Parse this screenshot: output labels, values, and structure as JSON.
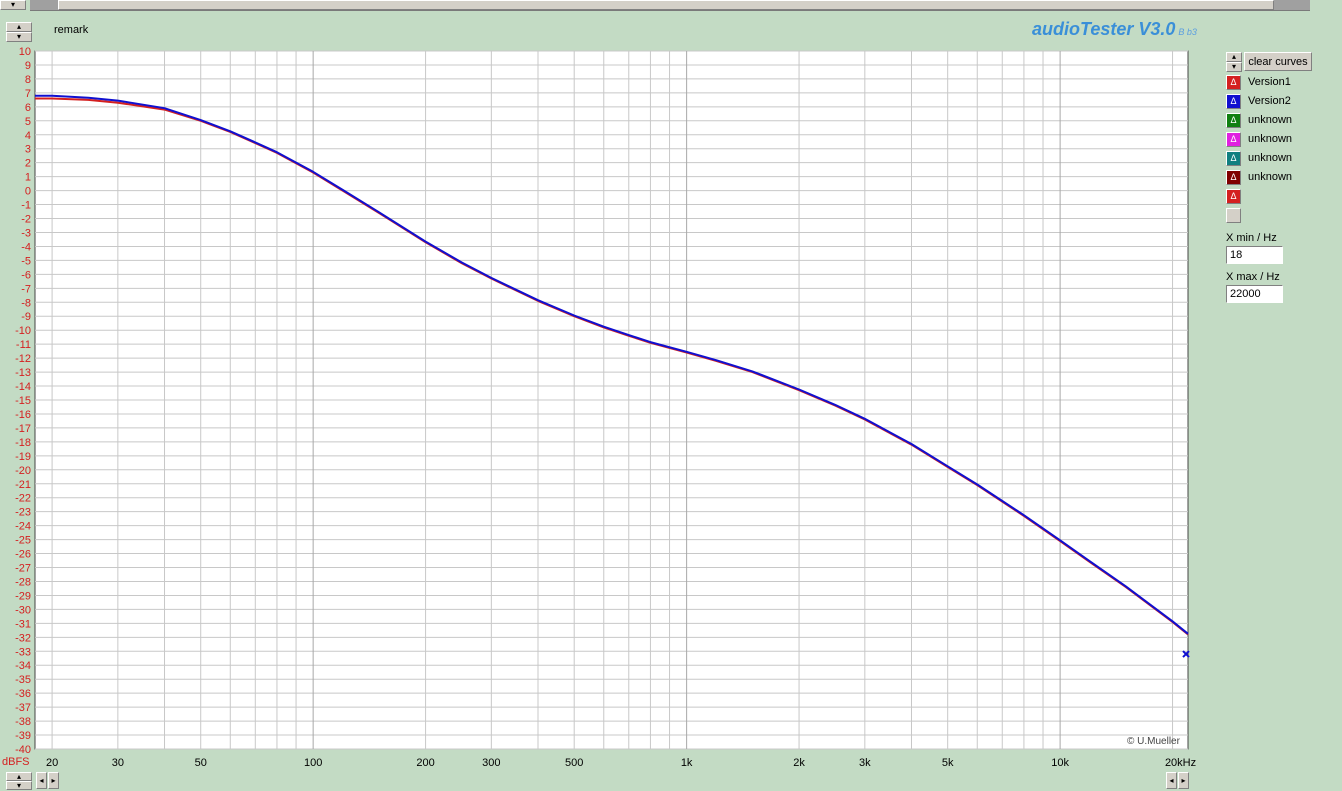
{
  "app": {
    "title": "audioTester V3.0",
    "version_sub": "B b3",
    "remark_label": "remark",
    "copyright": "© U.Mueller"
  },
  "controls": {
    "clear_curves_label": "clear curves",
    "xmin_label": "X min / Hz",
    "xmin_value": "18",
    "xmax_label": "X max / Hz",
    "xmax_value": "22000"
  },
  "legend": [
    {
      "label": "Version1",
      "color": "#d42020"
    },
    {
      "label": "Version2",
      "color": "#1010d0"
    },
    {
      "label": "unknown",
      "color": "#108010"
    },
    {
      "label": "unknown",
      "color": "#e020e0"
    },
    {
      "label": "unknown",
      "color": "#108080"
    },
    {
      "label": "unknown",
      "color": "#800000"
    },
    {
      "label": "",
      "color": "#d42020"
    },
    {
      "label": "",
      "color": "#d4d0c8"
    }
  ],
  "chart_data": {
    "type": "line",
    "xscale": "log",
    "xlim": [
      18,
      22000
    ],
    "ylim": [
      -40,
      10
    ],
    "ylabel": "dBFS",
    "grid": true,
    "y_ticks": [
      10,
      9,
      8,
      7,
      6,
      5,
      4,
      3,
      2,
      1,
      0,
      -1,
      -2,
      -3,
      -4,
      -5,
      -6,
      -7,
      -8,
      -9,
      -10,
      -11,
      -12,
      -13,
      -14,
      -15,
      -16,
      -17,
      -18,
      -19,
      -20,
      -21,
      -22,
      -23,
      -24,
      -25,
      -26,
      -27,
      -28,
      -29,
      -30,
      -31,
      -32,
      -33,
      -34,
      -35,
      -36,
      -37,
      -38,
      -39,
      -40
    ],
    "x_tick_labels": [
      {
        "value": 20,
        "label": "20"
      },
      {
        "value": 30,
        "label": "30"
      },
      {
        "value": 50,
        "label": "50"
      },
      {
        "value": 100,
        "label": "100"
      },
      {
        "value": 200,
        "label": "200"
      },
      {
        "value": 300,
        "label": "300"
      },
      {
        "value": 500,
        "label": "500"
      },
      {
        "value": 1000,
        "label": "1k"
      },
      {
        "value": 2000,
        "label": "2k"
      },
      {
        "value": 3000,
        "label": "3k"
      },
      {
        "value": 5000,
        "label": "5k"
      },
      {
        "value": 10000,
        "label": "10k"
      },
      {
        "value": 20000,
        "label": "20kHz"
      }
    ],
    "series": [
      {
        "name": "Version1",
        "color": "#d42020",
        "x": [
          18,
          20,
          25,
          30,
          40,
          50,
          60,
          70,
          80,
          100,
          120,
          150,
          200,
          250,
          300,
          400,
          500,
          600,
          700,
          800,
          1000,
          1200,
          1500,
          2000,
          2500,
          3000,
          4000,
          5000,
          6000,
          8000,
          10000,
          12000,
          15000,
          20000,
          22000
        ],
        "y": [
          6.6,
          6.6,
          6.5,
          6.3,
          5.8,
          5.0,
          4.2,
          3.4,
          2.7,
          1.3,
          0.0,
          -1.6,
          -3.7,
          -5.2,
          -6.3,
          -7.9,
          -9.0,
          -9.8,
          -10.4,
          -10.9,
          -11.6,
          -12.2,
          -13.0,
          -14.3,
          -15.4,
          -16.4,
          -18.2,
          -19.8,
          -21.1,
          -23.3,
          -25.1,
          -26.6,
          -28.4,
          -30.9,
          -31.8
        ]
      },
      {
        "name": "Version2",
        "color": "#1010d0",
        "x": [
          18,
          20,
          25,
          30,
          40,
          50,
          60,
          70,
          80,
          100,
          120,
          150,
          200,
          250,
          300,
          400,
          500,
          600,
          700,
          800,
          1000,
          1200,
          1500,
          2000,
          2500,
          3000,
          4000,
          5000,
          6000,
          8000,
          10000,
          12000,
          15000,
          20000,
          22000
        ],
        "y": [
          6.8,
          6.8,
          6.65,
          6.45,
          5.9,
          5.05,
          4.25,
          3.45,
          2.75,
          1.35,
          0.05,
          -1.55,
          -3.65,
          -5.15,
          -6.25,
          -7.85,
          -8.95,
          -9.75,
          -10.35,
          -10.85,
          -11.55,
          -12.15,
          -12.95,
          -14.25,
          -15.35,
          -16.35,
          -18.15,
          -19.75,
          -21.05,
          -23.25,
          -25.05,
          -26.55,
          -28.35,
          -30.85,
          -31.75
        ]
      }
    ],
    "marker": {
      "x": 22000,
      "y": -33.2,
      "color": "#1010d0"
    }
  }
}
